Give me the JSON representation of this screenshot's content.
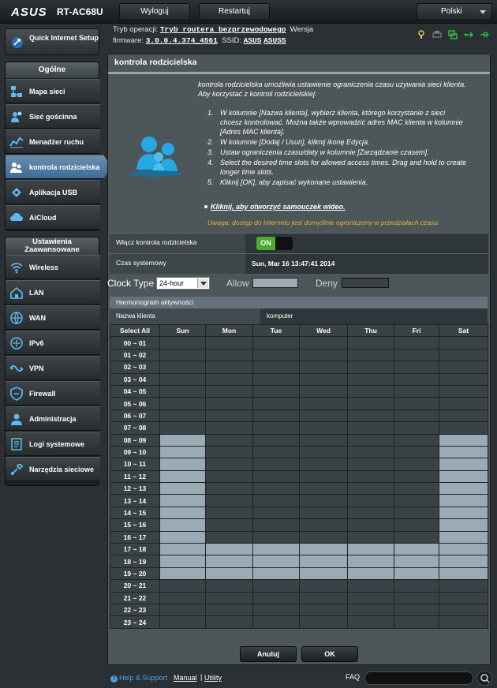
{
  "header": {
    "logo": "ASUS",
    "model": "RT-AC68U",
    "logout_label": "Wyloguj",
    "restart_label": "Restartuj",
    "language": "Polski"
  },
  "status": {
    "mode_label": "Tryb operacji:",
    "mode_value": "Tryb routera bezprzewodowego",
    "version_label": "Wersja",
    "firmware_label": "firmware:",
    "firmware_value": "3.0.0.4.374_4561",
    "ssid_label": "SSID:",
    "ssid_1": "ASUS",
    "ssid_2": "ASUS5",
    "icons": [
      "usb-flash-icon",
      "printer-icon",
      "network-icon",
      "usb-icon"
    ]
  },
  "sidebar": {
    "quick_setup": "Quick Internet Setup",
    "general_header": "Ogólne",
    "general": [
      {
        "label": "Mapa sieci",
        "icon": "network-map-icon"
      },
      {
        "label": "Sieć gościnna",
        "icon": "guest-network-icon"
      },
      {
        "label": "Menadżer ruchu",
        "icon": "traffic-manager-icon"
      },
      {
        "label": "kontrola rodzicielska",
        "icon": "parental-control-icon",
        "active": true
      },
      {
        "label": "Aplikacja USB",
        "icon": "usb-app-icon"
      },
      {
        "label": "AiCloud",
        "icon": "aicloud-icon"
      }
    ],
    "advanced_header": "Ustawienia Zaawansowane",
    "advanced": [
      {
        "label": "Wireless",
        "icon": "wireless-icon"
      },
      {
        "label": "LAN",
        "icon": "lan-icon"
      },
      {
        "label": "WAN",
        "icon": "wan-icon"
      },
      {
        "label": "IPv6",
        "icon": "ipv6-icon"
      },
      {
        "label": "VPN",
        "icon": "vpn-icon"
      },
      {
        "label": "Firewall",
        "icon": "firewall-icon"
      },
      {
        "label": "Administracja",
        "icon": "administration-icon"
      },
      {
        "label": "Logi systemowe",
        "icon": "system-log-icon"
      },
      {
        "label": "Narzędzia sieciowe",
        "icon": "network-tools-icon"
      }
    ]
  },
  "main": {
    "title": "kontrola rodzicielska",
    "description": "kontrola rodzicielska umożliwia ustawienie ograniczenia czasu używania sieci klienta. Aby korzystać z kontroli rodzicielskiej:",
    "steps": [
      "W kolumnie [Nazwa klienta], wybierz klienta, którego korzystanie z sieci chcesz kontrolować. Można także wprowadzić adres MAC klienta w kolumnie [Adres MAC klienta].",
      "W kolumnie [Dodaj / Usuń], kliknij ikonę Edycja.",
      "Ustaw ograniczenia czasu/daty w kolumnie [Zarządzanie czasem].",
      "Select the desired time slots for allowed access times. Drag and hold to create longer time slots.",
      "Kliknij [OK], aby zapisać wykonane ustawienia."
    ],
    "video_link": "Kliknij, aby otworzyć samouczek wideo.",
    "warning": "Uwaga: dostęp do Internetu jest domyślnie ograniczony w przedziałach czasu.",
    "enable_label": "Włącz kontrola rodzicielska",
    "enable_state": "ON",
    "system_time_label": "Czas systemowy",
    "system_time_value": "Sun, Mar 16 13:47:41 2014",
    "clock_type_label": "Clock Type",
    "clock_type_value": "24-hour",
    "allow_label": "Allow",
    "deny_label": "Deny",
    "schedule_header": "Harmonogram aktywności",
    "client_name_label": "Nazwa klienta",
    "client_name_value": "komputer",
    "select_all": "Select All",
    "days": [
      "Sun",
      "Mon",
      "Tue",
      "Wed",
      "Thu",
      "Fri",
      "Sat"
    ],
    "hours": [
      "00 ~ 01",
      "01 ~ 02",
      "02 ~ 03",
      "03 ~ 04",
      "04 ~ 05",
      "05 ~ 06",
      "06 ~ 07",
      "07 ~ 08",
      "08 ~ 09",
      "09 ~ 10",
      "10 ~ 11",
      "11 ~ 12",
      "12 ~ 13",
      "13 ~ 14",
      "14 ~ 15",
      "15 ~ 16",
      "16 ~ 17",
      "17 ~ 18",
      "18 ~ 19",
      "19 ~ 20",
      "20 ~ 21",
      "21 ~ 22",
      "22 ~ 23",
      "23 ~ 24"
    ],
    "allowed": {
      "Sun": [
        8,
        9,
        10,
        11,
        12,
        13,
        14,
        15,
        16,
        17,
        18,
        19
      ],
      "Mon": [
        17,
        18,
        19
      ],
      "Tue": [
        17,
        18,
        19
      ],
      "Wed": [
        17,
        18,
        19
      ],
      "Thu": [
        17,
        18,
        19
      ],
      "Fri": [
        17,
        18,
        19
      ],
      "Sat": [
        8,
        9,
        10,
        11,
        12,
        13,
        14,
        15,
        16,
        17,
        18,
        19
      ]
    },
    "cancel_label": "Anuluj",
    "ok_label": "OK"
  },
  "footer": {
    "help": "Help & Support",
    "manual": "Manual",
    "separator": "|",
    "utility": "Utility",
    "faq": "FAQ"
  },
  "colors": {
    "allow": "#9aabb5",
    "deny": "#3a4245",
    "warning": "#e9b23a",
    "active_nav": "#4f7ea8",
    "toggle_on": "#4caa2c"
  }
}
